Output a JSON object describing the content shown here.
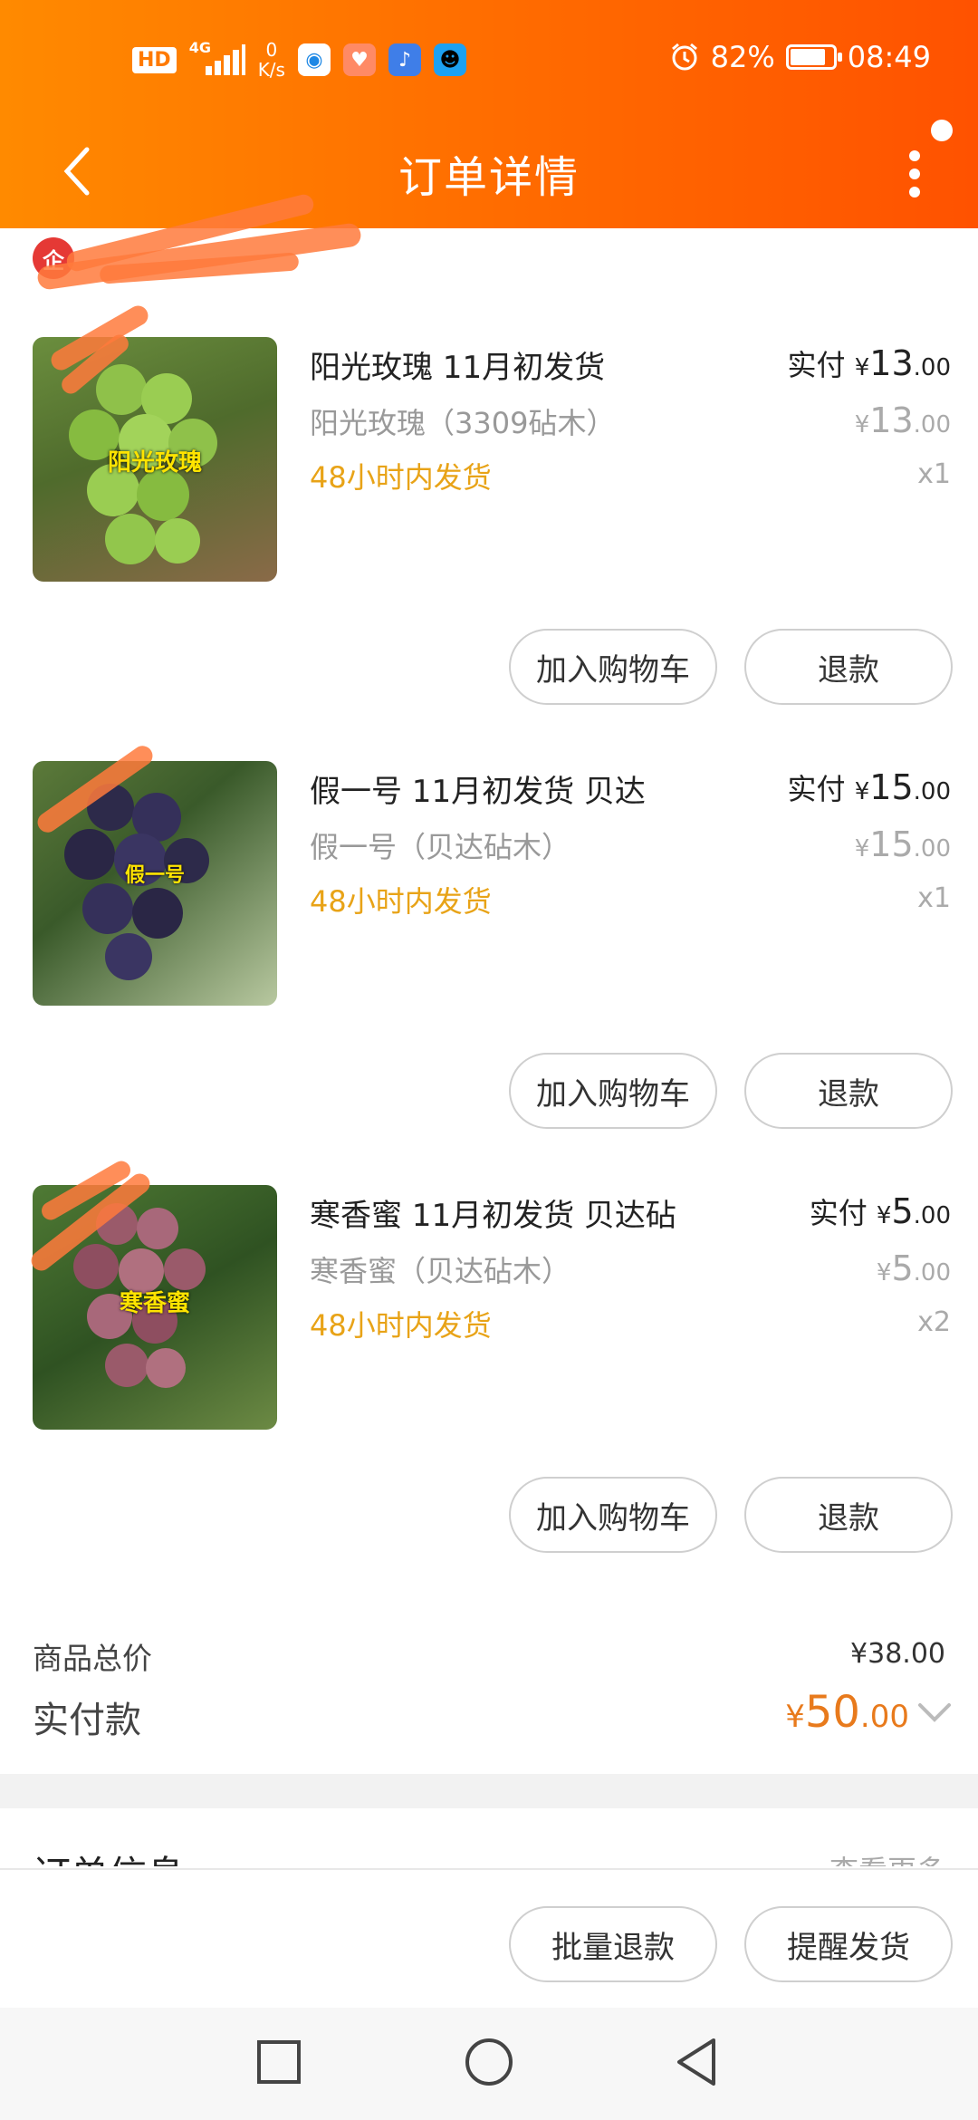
{
  "status_bar": {
    "hd": "HD",
    "network": "4G",
    "speed_value": "0",
    "speed_unit": "K/s",
    "battery": "82%",
    "battery_level": 0.82,
    "time": "08:49",
    "apps": [
      "browser-icon",
      "health-icon",
      "music-icon",
      "qq-icon"
    ]
  },
  "nav": {
    "title": "订单详情"
  },
  "items": [
    {
      "title": "阳光玫瑰   11月初发货",
      "sku": "阳光玫瑰（3309砧木）",
      "ship": "48小时内发货",
      "paid_label": "实付",
      "currency": "¥",
      "paid_int": "13",
      "paid_dec": ".00",
      "orig_int": "13",
      "orig_dec": ".00",
      "qty": "x1",
      "thumb_label": "阳光玫瑰",
      "cart_btn": "加入购物车",
      "refund_btn": "退款"
    },
    {
      "title": "假一号   11月初发货  贝达",
      "sku": "假一号（贝达砧木）",
      "ship": "48小时内发货",
      "paid_label": "实付",
      "currency": "¥",
      "paid_int": "15",
      "paid_dec": ".00",
      "orig_int": "15",
      "orig_dec": ".00",
      "qty": "x1",
      "thumb_label": "假一号",
      "cart_btn": "加入购物车",
      "refund_btn": "退款"
    },
    {
      "title": "寒香蜜   11月初发货  贝达砧",
      "sku": "寒香蜜（贝达砧木）",
      "ship": "48小时内发货",
      "paid_label": "实付",
      "currency": "¥",
      "paid_int": "5",
      "paid_dec": ".00",
      "orig_int": "5",
      "orig_dec": ".00",
      "qty": "x2",
      "thumb_label": "寒香蜜",
      "cart_btn": "加入购物车",
      "refund_btn": "退款"
    }
  ],
  "totals": {
    "goods_label": "商品总价",
    "goods_value": "¥38.00",
    "pay_label": "实付款",
    "currency": "¥",
    "pay_int": "50",
    "pay_dec": ".00"
  },
  "order_info": {
    "title": "订单信息",
    "more": "查看更多"
  },
  "bottom": {
    "batch_refund": "批量退款",
    "remind_ship": "提醒发货"
  },
  "colors": {
    "header_orange": "#ff6a00",
    "ship_yellow": "#e8a317",
    "pay_orange": "#e87a1c"
  }
}
